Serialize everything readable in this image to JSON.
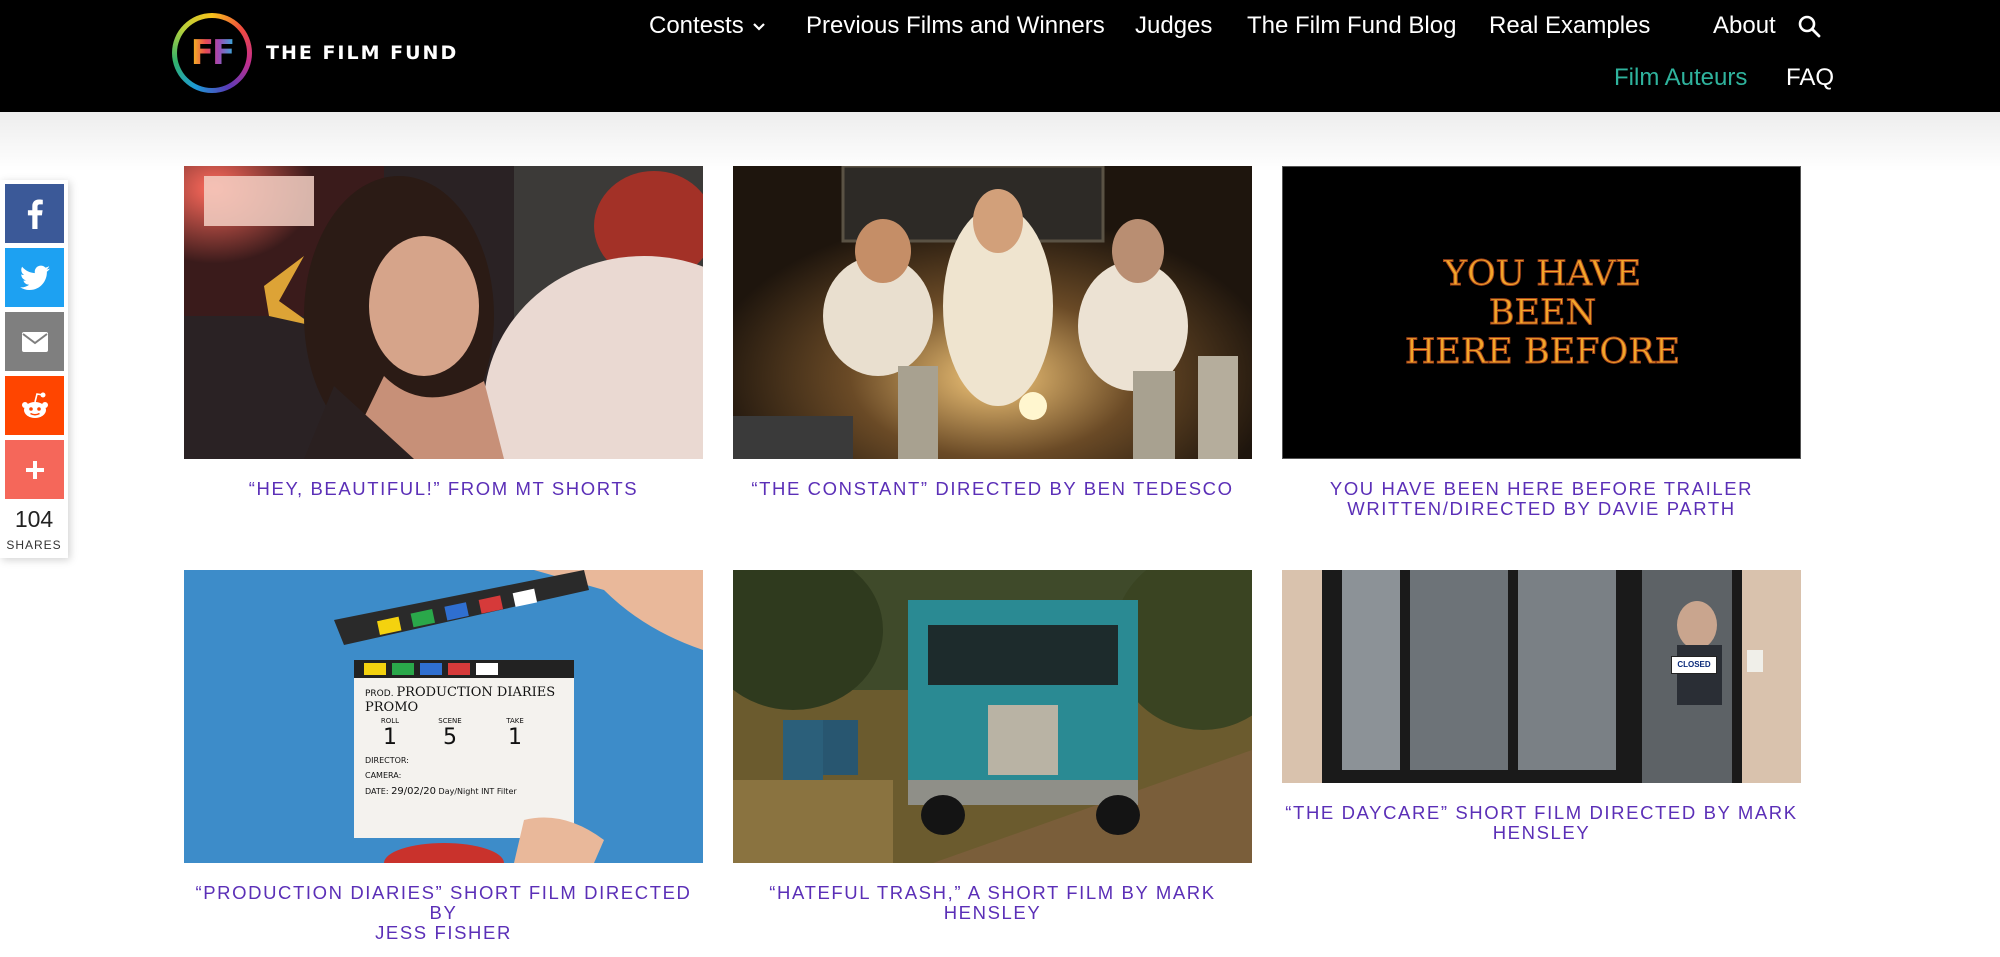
{
  "brand": {
    "logo_mark": "FF",
    "name": "THE FILM FUND"
  },
  "nav": {
    "row1": [
      {
        "label": "Contests",
        "has_dropdown": true
      },
      {
        "label": "Previous Films and Winners"
      },
      {
        "label": "Judges"
      },
      {
        "label": "The Film Fund Blog"
      },
      {
        "label": "Real Examples"
      },
      {
        "label": "About"
      }
    ],
    "row2": [
      {
        "label": "Film Auteurs",
        "active": true
      },
      {
        "label": "FAQ"
      }
    ],
    "search_icon": "search-icon"
  },
  "share": {
    "buttons": [
      {
        "network": "facebook",
        "icon": "facebook-icon",
        "color": "#3b5998"
      },
      {
        "network": "twitter",
        "icon": "twitter-icon",
        "color": "#1da1f2"
      },
      {
        "network": "email",
        "icon": "email-icon",
        "color": "#7f7f7f"
      },
      {
        "network": "reddit",
        "icon": "reddit-icon",
        "color": "#ff4500"
      },
      {
        "network": "more",
        "icon": "plus-icon",
        "color": "#f5675a"
      }
    ],
    "count": "104",
    "count_label": "SHARES"
  },
  "films": [
    {
      "caption": "“HEY, BEAUTIFUL!” FROM MT SHORTS"
    },
    {
      "caption": "“THE CONSTANT” DIRECTED BY BEN TEDESCO"
    },
    {
      "caption_line1": "YOU HAVE BEEN HERE BEFORE TRAILER",
      "caption_line2": "WRITTEN/DIRECTED BY DAVIE PARTH",
      "thumb_title_line1": "YOU HAVE",
      "thumb_title_line2": "BEEN",
      "thumb_title_line3": "HERE BEFORE"
    },
    {
      "caption_line1": "“PRODUCTION DIARIES” SHORT FILM DIRECTED BY",
      "caption_line2": "JESS FISHER",
      "slate": {
        "prod": "PROD.",
        "title": "PRODUCTION DIARIES PROMO",
        "roll_label": "ROLL",
        "roll": "1",
        "scene_label": "SCENE",
        "scene": "5",
        "take_label": "TAKE",
        "take": "1",
        "director_label": "DIRECTOR:",
        "camera_label": "CAMERA:",
        "date_label": "DATE:",
        "date": "29/02/20",
        "day_night": "Day/Night",
        "int_ext": "INT",
        "filter": "Filter"
      }
    },
    {
      "caption_line1": "“HATEFUL TRASH,” A SHORT FILM BY MARK",
      "caption_line2": "HENSLEY"
    },
    {
      "caption_line1": "“THE DAYCARE” SHORT FILM DIRECTED BY MARK",
      "caption_line2": "HENSLEY",
      "sign": "CLOSED"
    }
  ]
}
